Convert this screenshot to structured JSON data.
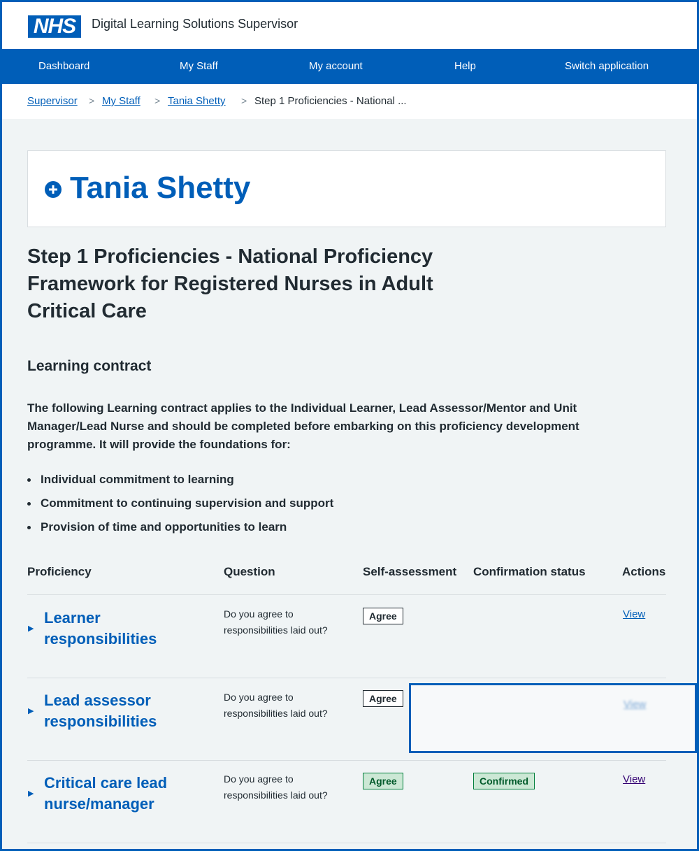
{
  "header": {
    "logo_text": "NHS",
    "service_name": "Digital Learning Solutions Supervisor"
  },
  "nav": {
    "items": [
      "Dashboard",
      "My Staff",
      "My account",
      "Help",
      "Switch application"
    ]
  },
  "breadcrumb": {
    "links": [
      "Supervisor",
      "My Staff",
      "Tania Shetty"
    ],
    "separator": ">",
    "current": "Step 1 Proficiencies - National ..."
  },
  "staff": {
    "name": "Tania Shetty",
    "icon": "plus-circle-icon"
  },
  "page": {
    "title": "Step 1 Proficiencies - National Proficiency Framework for Registered Nurses in Adult Critical Care",
    "section_title": "Learning contract",
    "intro": "The following Learning contract applies to the Individual Learner, Lead Assessor/Mentor and Unit Manager/Lead Nurse and should be completed before embarking on this proficiency development programme. It will provide the foundations for:",
    "bullets": [
      "Individual commitment to learning",
      "Commitment to continuing supervision and support",
      "Provision of time and opportunities to learn"
    ]
  },
  "table": {
    "headers": [
      "Proficiency",
      "Question",
      "Self-assessment",
      "Confirmation status",
      "Actions"
    ],
    "rows": [
      {
        "proficiency": "Learner responsibilities",
        "question": "Do you agree to responsibilities laid out?",
        "self_assessment": "Agree",
        "confirmation": "",
        "action": "View"
      },
      {
        "proficiency": "Lead assessor responsibilities",
        "question": "Do you agree to responsibilities laid out?",
        "self_assessment": "Agree",
        "confirmation": "",
        "action": "View"
      },
      {
        "proficiency": "Critical care lead nurse/manager",
        "question": "Do you agree to responsibilities laid out?",
        "self_assessment": "Agree",
        "confirmation": "Confirmed",
        "action": "View"
      }
    ]
  },
  "colors": {
    "nhs_blue": "#005eb8",
    "background": "#f0f4f5",
    "text": "#212b32",
    "success_green": "#007f3b",
    "visited_purple": "#330072"
  }
}
